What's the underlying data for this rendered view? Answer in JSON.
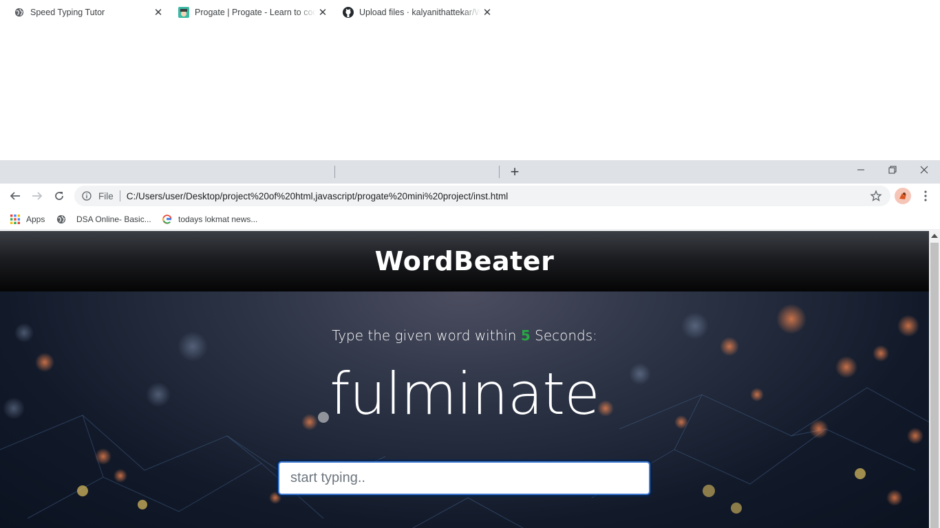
{
  "browser": {
    "tabs": [
      {
        "title": "Speed Typing Tutor",
        "icon": "globe-icon",
        "active": true
      },
      {
        "title": "Progate | Progate - Learn to code",
        "icon": "progate-icon",
        "active": false
      },
      {
        "title": "Upload files · kalyanithattekar/Wo",
        "icon": "github-icon",
        "active": false
      }
    ],
    "address": {
      "scheme_label": "File",
      "url": "C:/Users/user/Desktop/project%20of%20html,javascript/progate%20mini%20project/inst.html"
    },
    "bookmarks": [
      {
        "label": "Apps",
        "icon": "apps-grid-icon"
      },
      {
        "label": "DSA Online- Basic...",
        "icon": "globe-icon"
      },
      {
        "label": "todays lokmat news...",
        "icon": "google-icon"
      }
    ]
  },
  "page": {
    "brand": "WordBeater",
    "instruction_prefix": "Type the given word within",
    "seconds": "5",
    "instruction_suffix": "Seconds:",
    "current_word": "fulminate",
    "input_placeholder": "start typing.."
  },
  "colors": {
    "seconds_accent": "#28a745",
    "input_focus_border": "#3d7bd6"
  }
}
